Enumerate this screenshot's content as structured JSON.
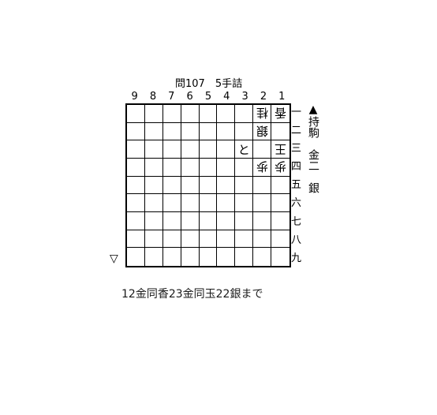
{
  "title": "問107　5手詰",
  "files": [
    "9",
    "8",
    "7",
    "6",
    "5",
    "4",
    "3",
    "2",
    "1"
  ],
  "ranks": [
    "一",
    "二",
    "三",
    "四",
    "五",
    "六",
    "七",
    "八",
    "九"
  ],
  "pieces": [
    {
      "file": 1,
      "rank": 1,
      "piece": "香",
      "side": "gote"
    },
    {
      "file": 2,
      "rank": 1,
      "piece": "桂",
      "side": "gote"
    },
    {
      "file": 2,
      "rank": 2,
      "piece": "銀",
      "side": "gote"
    },
    {
      "file": 1,
      "rank": 3,
      "piece": "王",
      "side": "gote"
    },
    {
      "file": 3,
      "rank": 3,
      "piece": "と",
      "side": "sente"
    },
    {
      "file": 2,
      "rank": 4,
      "piece": "歩",
      "side": "gote"
    },
    {
      "file": 1,
      "rank": 4,
      "piece": "歩",
      "side": "gote"
    }
  ],
  "sente_hand": "▲持駒　金二　銀",
  "gote_mark": "▽",
  "solution": "12金同香23金同玉22銀まで"
}
